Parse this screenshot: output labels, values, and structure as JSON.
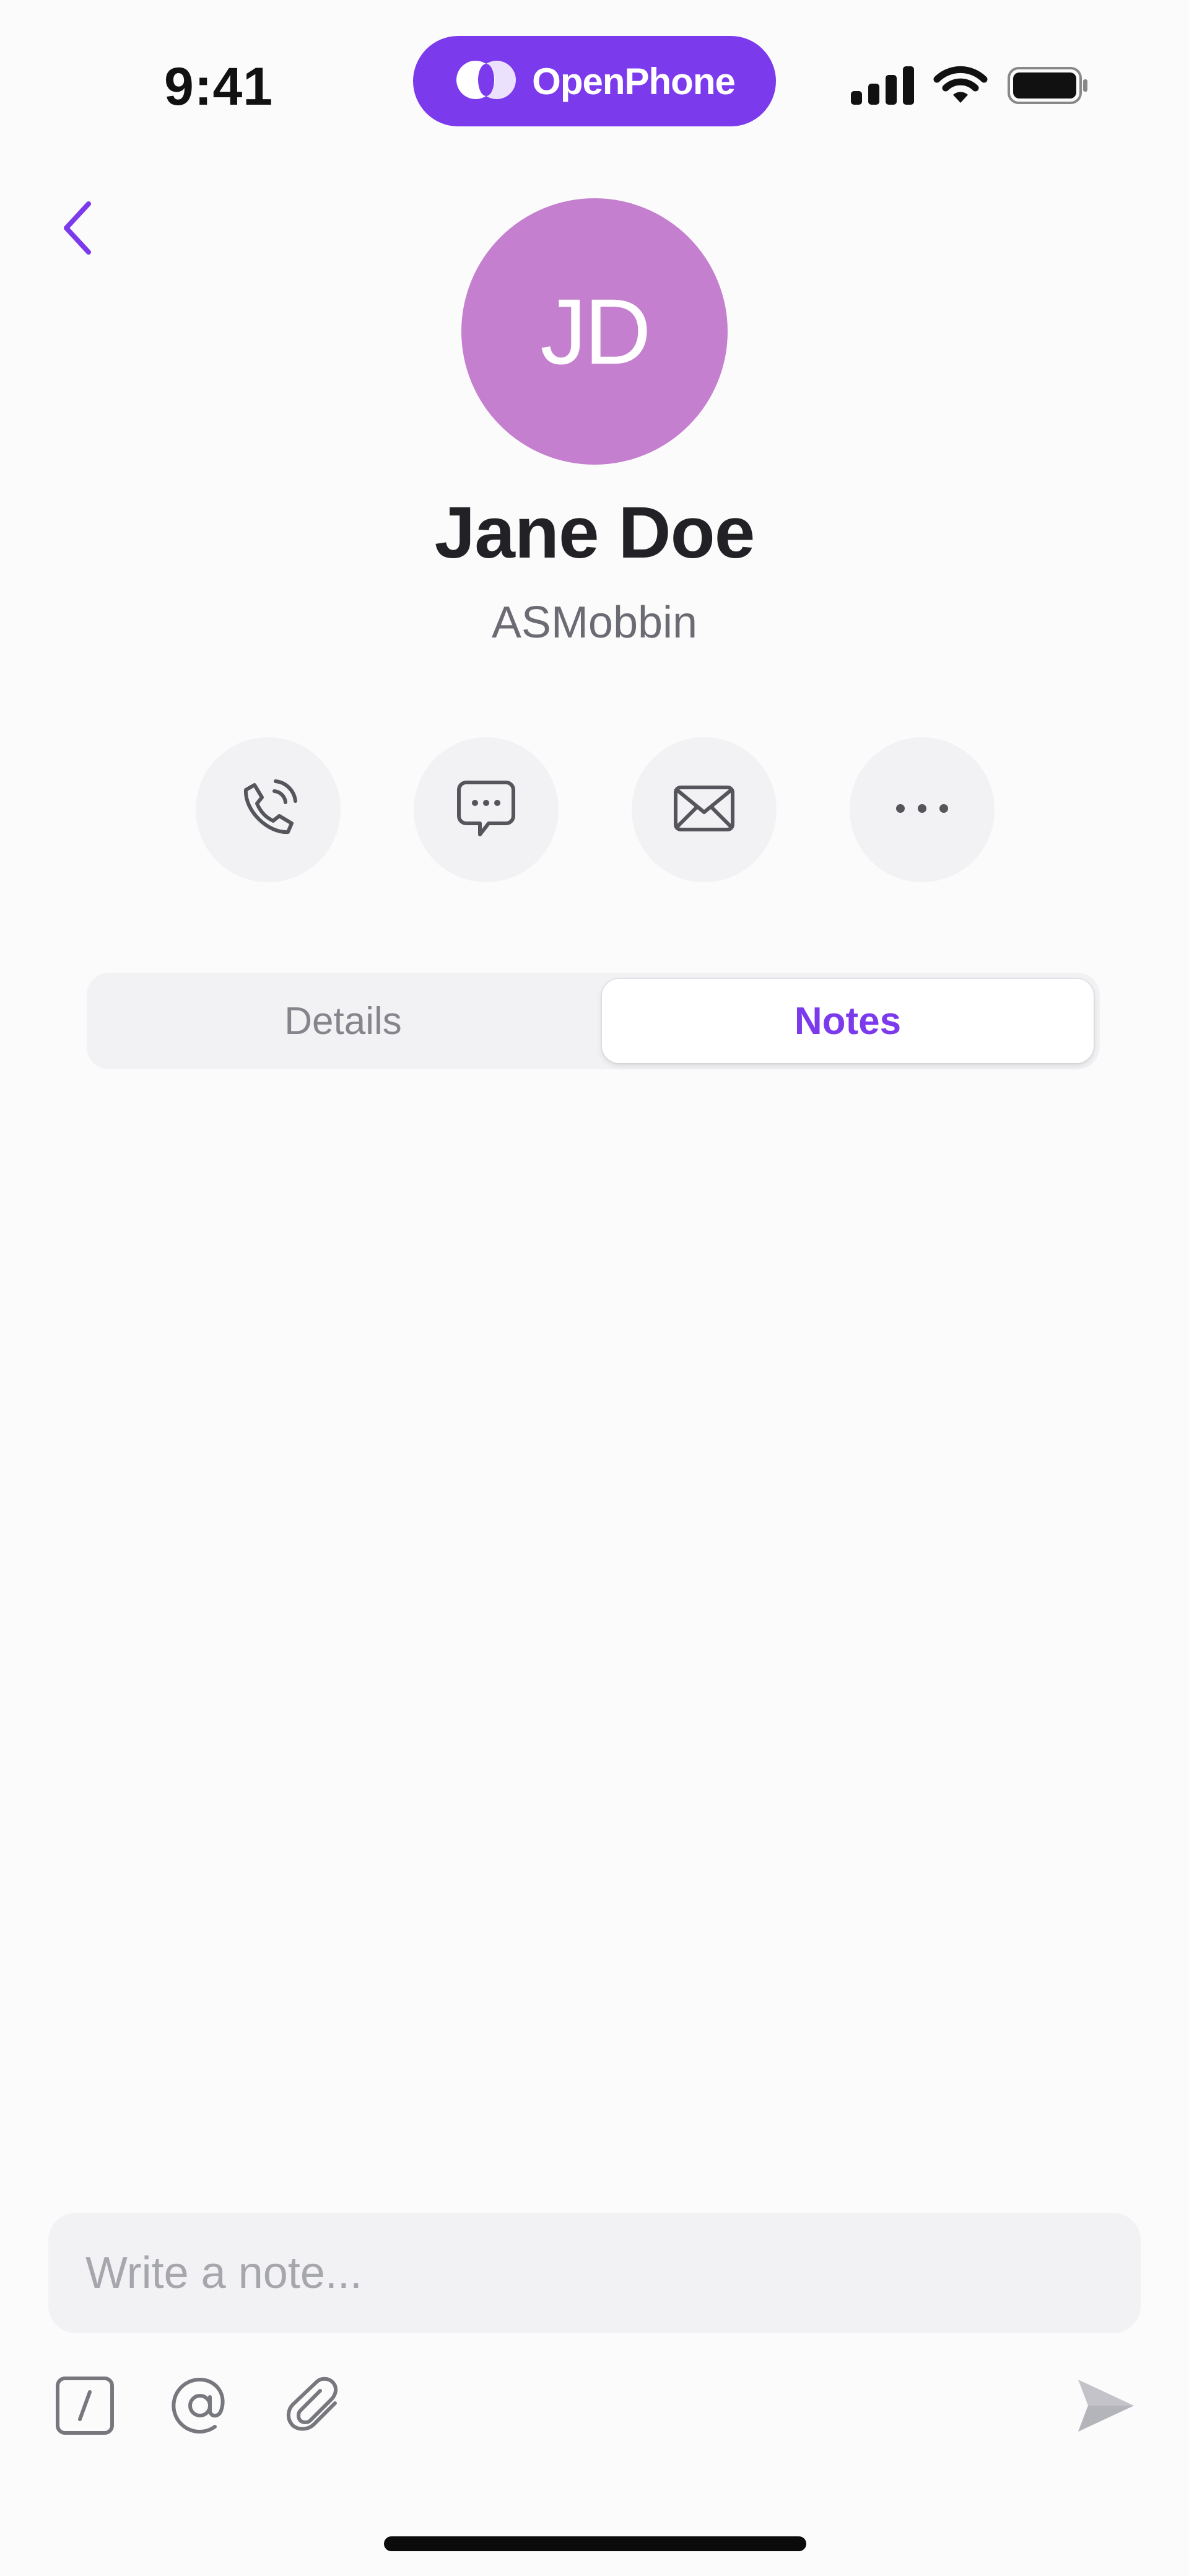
{
  "status_bar": {
    "time": "9:41",
    "island_brand": "OpenPhone",
    "icons": [
      "signal-icon",
      "wifi-icon",
      "battery-icon"
    ]
  },
  "contact": {
    "initials": "JD",
    "name": "Jane Doe",
    "company": "ASMobbin",
    "avatar_color": "#c47fcf"
  },
  "actions": [
    {
      "icon": "phone-call-icon"
    },
    {
      "icon": "message-icon"
    },
    {
      "icon": "mail-icon"
    },
    {
      "icon": "more-icon"
    }
  ],
  "tabs": {
    "details": "Details",
    "notes": "Notes",
    "selected": "Notes"
  },
  "composer": {
    "placeholder": "Write a note...",
    "tools": [
      "slash-command-icon",
      "mention-icon",
      "attachment-icon"
    ],
    "send_icon": "send-icon"
  },
  "colors": {
    "accent": "#7c3aed",
    "background": "#fcfbfc",
    "button_bg": "#f2f1f4"
  }
}
